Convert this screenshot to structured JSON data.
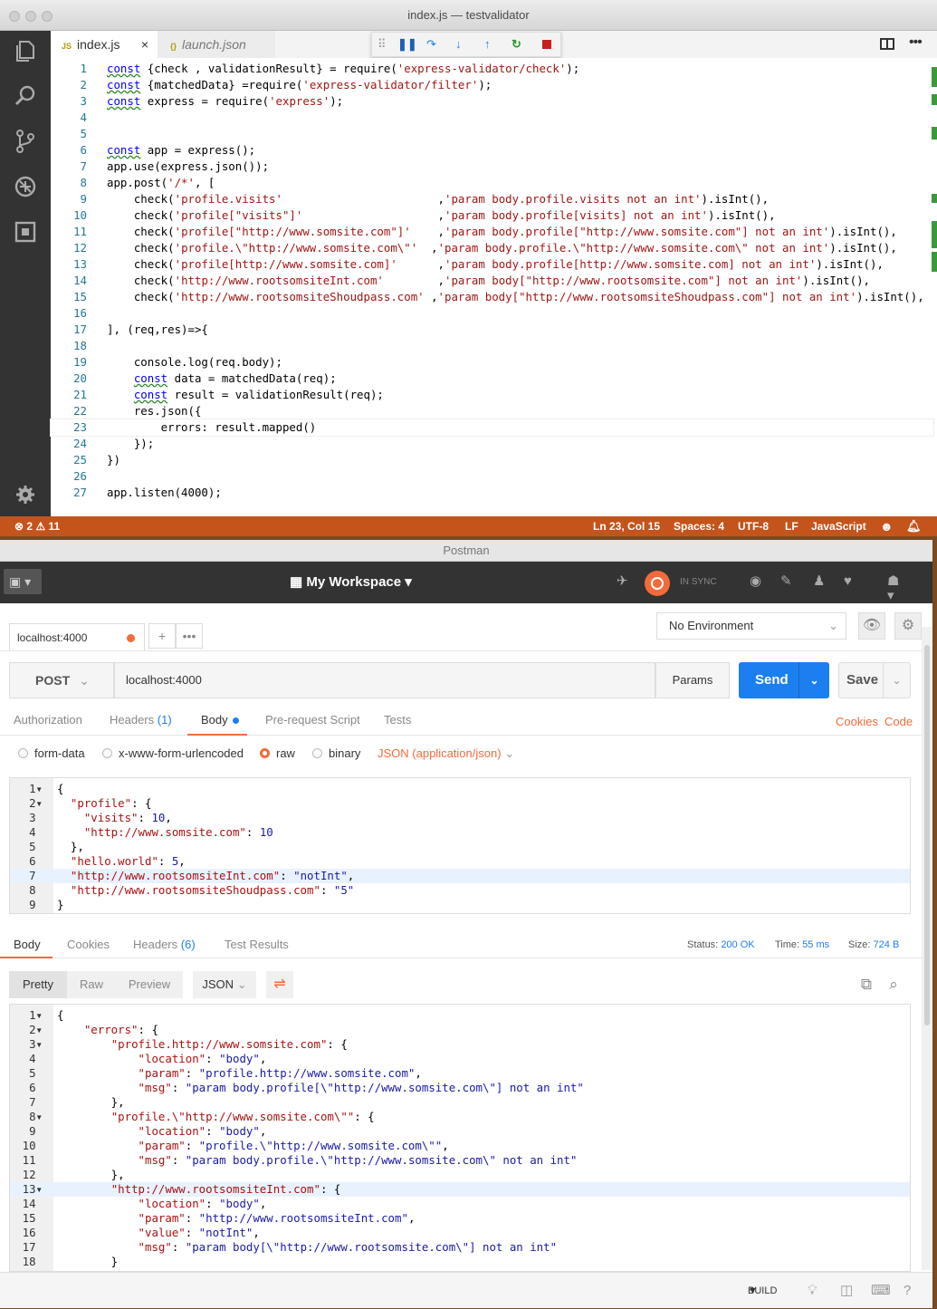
{
  "vscode": {
    "window_title": "index.js — testvalidator",
    "tabs": [
      {
        "icon": "JS",
        "label": "index.js",
        "close": "×"
      },
      {
        "icon": "{}",
        "label": "launch.json"
      }
    ],
    "code_lines": [
      "const {check , validationResult} = require('express-validator/check');",
      "const {matchedData} =require('express-validator/filter');",
      "const express = require('express');",
      "",
      "",
      "const app = express();",
      "app.use(express.json());",
      "app.post('/*', [",
      "    check('profile.visits'                       ,'param body.profile.visits not an int').isInt(),",
      "    check('profile[\"visits\"]'                    ,'param body.profile[visits] not an int').isInt(),",
      "    check('profile[\"http://www.somsite.com\"]'    ,'param body.profile[\"http://www.somsite.com\"] not an int').isInt(),",
      "    check('profile.\\\"http://www.somsite.com\\\"'  ,'param body.profile.\\\"http://www.somsite.com\\\" not an int').isInt(),",
      "    check('profile[http://www.somsite.com]'      ,'param body.profile[http://www.somsite.com] not an int').isInt(),",
      "    check('http://www.rootsomsiteInt.com'        ,'param body[\"http://www.rootsomsite.com\"] not an int').isInt(),",
      "    check('http://www.rootsomsiteShoudpass.com' ,'param body[\"http://www.rootsomsiteShoudpass.com\"] not an int').isInt(),",
      "",
      "], (req,res)=>{",
      "",
      "    console.log(req.body);",
      "    const data = matchedData(req);",
      "    const result = validationResult(req);",
      "    res.json({",
      "        errors: result.mapped()",
      "    });",
      "})",
      "",
      "app.listen(4000);"
    ],
    "status": {
      "errors": "2",
      "warnings": "11",
      "position": "Ln 23, Col 15",
      "spaces": "Spaces: 4",
      "encoding": "UTF-8",
      "eol": "LF",
      "language": "JavaScript"
    }
  },
  "postman": {
    "window_title": "Postman",
    "workspace": "My Workspace",
    "sync_status": "IN SYNC",
    "request_tab": "localhost:4000",
    "environment": "No Environment",
    "method": "POST",
    "url": "localhost:4000",
    "params_label": "Params",
    "send_label": "Send",
    "save_label": "Save",
    "request_tabs": [
      "Authorization",
      "Headers",
      "Body",
      "Pre-request Script",
      "Tests"
    ],
    "headers_count": "(1)",
    "cookies_link": "Cookies",
    "code_link": "Code",
    "body_modes": [
      "form-data",
      "x-www-form-urlencoded",
      "raw",
      "binary"
    ],
    "content_type": "JSON (application/json)",
    "request_body_lines": [
      "{",
      "  \"profile\": {",
      "    \"visits\": 10,",
      "    \"http://www.somsite.com\": 10",
      "  },",
      "  \"hello.world\": 5,",
      "  \"http://www.rootsomsiteInt.com\": \"notInt\",",
      "  \"http://www.rootsomsiteShoudpass.com\": \"5\"",
      "}"
    ],
    "response_tabs": [
      "Body",
      "Cookies",
      "Headers",
      "Test Results"
    ],
    "response_headers_count": "(6)",
    "status_label": "Status:",
    "status_value": "200 OK",
    "time_label": "Time:",
    "time_value": "55 ms",
    "size_label": "Size:",
    "size_value": "724 B",
    "view_modes": [
      "Pretty",
      "Raw",
      "Preview"
    ],
    "format": "JSON",
    "response_lines": [
      "{",
      "    \"errors\": {",
      "        \"profile.http://www.somsite.com\": {",
      "            \"location\": \"body\",",
      "            \"param\": \"profile.http://www.somsite.com\",",
      "            \"msg\": \"param body.profile[\\\"http://www.somsite.com\\\"] not an int\"",
      "        },",
      "        \"profile.\\\"http://www.somsite.com\\\"\": {",
      "            \"location\": \"body\",",
      "            \"param\": \"profile.\\\"http://www.somsite.com\\\"\",",
      "            \"msg\": \"param body.profile.\\\"http://www.somsite.com\\\" not an int\"",
      "        },",
      "        \"http://www.rootsomsiteInt.com\": {",
      "            \"location\": \"body\",",
      "            \"param\": \"http://www.rootsomsiteInt.com\",",
      "            \"value\": \"notInt\",",
      "            \"msg\": \"param body[\\\"http://www.rootsomsite.com\\\"] not an int\"",
      "        }"
    ],
    "build_label": "BUILD"
  }
}
